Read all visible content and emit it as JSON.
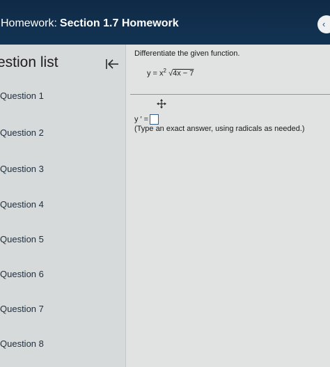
{
  "header": {
    "prefix": "Homework:",
    "title": "Section 1.7 Homework",
    "collapse_glyph": "‹"
  },
  "sidebar": {
    "title": "estion list",
    "collapse_icon": "collapse-left-icon",
    "questions": [
      "Question 1",
      "Question 2",
      "Question 3",
      "Question 4",
      "Question 5",
      "Question 6",
      "Question 7",
      "Question 8"
    ]
  },
  "problem": {
    "instruction": "Differentiate the given function.",
    "formula_lhs": "y = x",
    "formula_exponent": "2",
    "formula_radical_sign": "√",
    "formula_radicand": "4x − 7",
    "answer_label": "y ′ =",
    "hint": "(Type an exact answer, using radicals as needed.)",
    "move_icon": "move-arrows-icon"
  },
  "colors": {
    "header_bg": "#133354",
    "sidebar_bg": "#d7dada",
    "main_bg": "#e1e3e2",
    "answer_box_border": "#2f5f8a"
  }
}
